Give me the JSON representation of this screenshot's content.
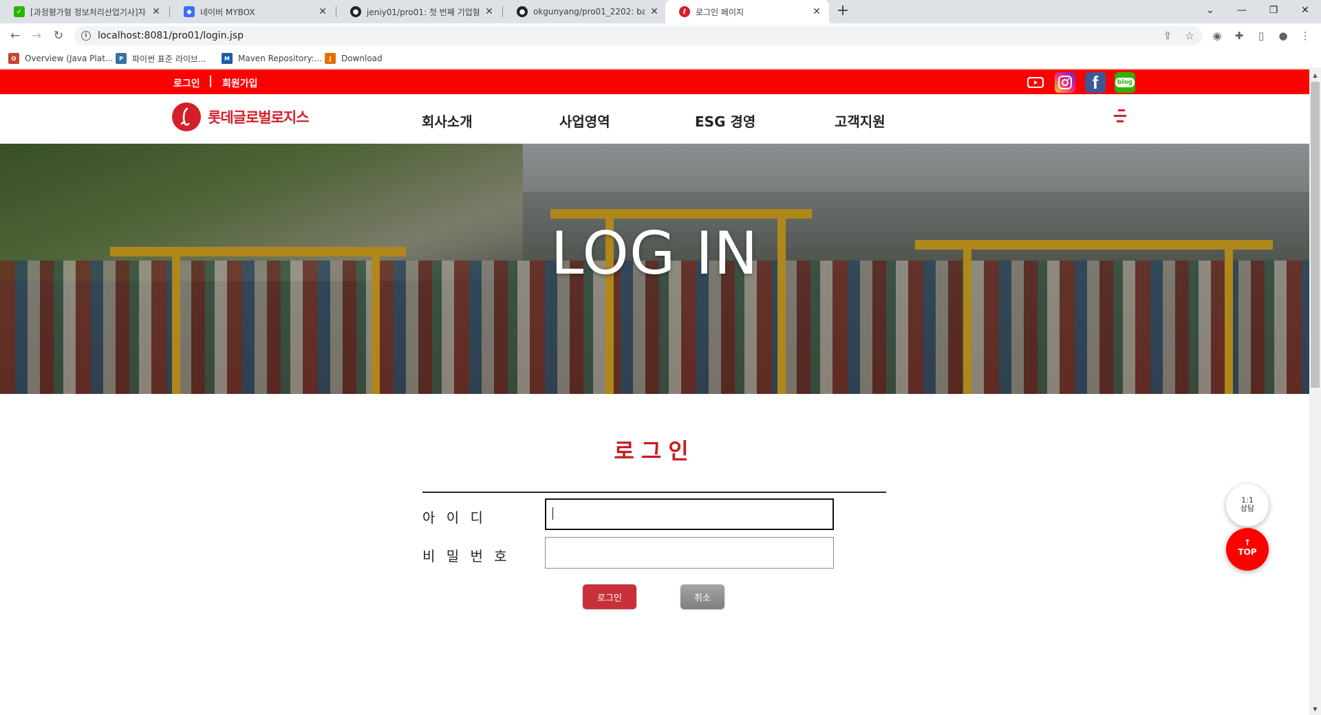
{
  "browser": {
    "tabs": [
      {
        "title": "[과정평가형 정보처리산업기사]자",
        "favicon": "green-cart"
      },
      {
        "title": "네이버 MYBOX",
        "favicon": "blue-hex"
      },
      {
        "title": "jeniy01/pro01: 첫 번째 기업형 홈",
        "favicon": "github"
      },
      {
        "title": "okgunyang/pro01_2202: backend",
        "favicon": "github"
      },
      {
        "title": "로그인 페이지",
        "favicon": "lotte"
      }
    ],
    "url": "localhost:8081/pro01/login.jsp",
    "bookmarks": [
      {
        "label": "Overview (Java Plat...",
        "icon": "oracle-icon"
      },
      {
        "label": "파이썬 표준 라이브...",
        "icon": "python-icon"
      },
      {
        "label": "Maven Repository:...",
        "icon": "maven-icon"
      },
      {
        "label": "Download",
        "icon": "java-icon"
      }
    ]
  },
  "site": {
    "top_links": {
      "login": "로그인",
      "join": "회원가입"
    },
    "logo_text": "롯데글로벌로지스",
    "menu": [
      "회사소개",
      "사업영역",
      "ESG 경영",
      "고객지원"
    ],
    "hero_title": "LOG IN",
    "social": {
      "blog": "blog"
    },
    "brand_color": "#ff0000"
  },
  "login": {
    "title": "로그인",
    "id_label": "아 이 디",
    "pw_label": "비 밀 번 호",
    "id_value": "",
    "pw_value": "",
    "login_button": "로그인",
    "cancel_button": "취소"
  },
  "floating": {
    "consult_line1": "1:1",
    "consult_line2": "상담",
    "top_arrow": "↑",
    "top_label": "TOP"
  }
}
